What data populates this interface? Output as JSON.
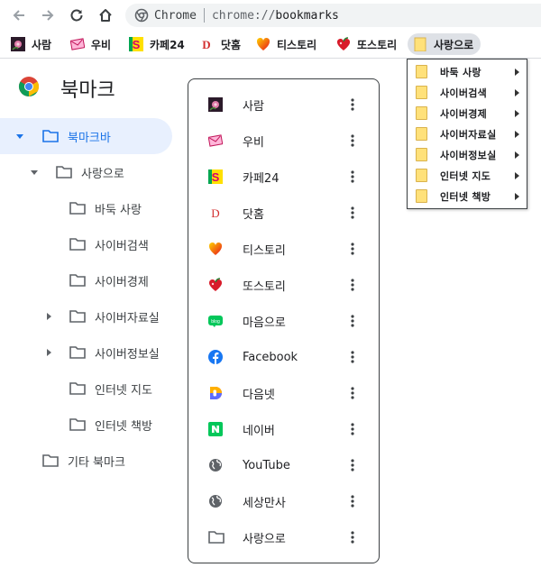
{
  "omnibox": {
    "scheme_label": "Chrome",
    "url_prefix": "chrome://",
    "url_host": "bookmarks"
  },
  "bookmarks_bar": [
    {
      "label": "사람",
      "icon": "flower-photo-icon"
    },
    {
      "label": "우비",
      "icon": "pink-envelope-icon"
    },
    {
      "label": "카페24",
      "icon": "cafe24-icon"
    },
    {
      "label": "닷홈",
      "icon": "dothome-d-icon"
    },
    {
      "label": "티스토리",
      "icon": "heart-icon"
    },
    {
      "label": "또스토리",
      "icon": "cherry-heart-icon"
    },
    {
      "label": "사랑으로",
      "icon": "folder-icon"
    }
  ],
  "page": {
    "title": "북마크"
  },
  "tree": [
    {
      "label": "북마크바"
    },
    {
      "label": "사랑으로"
    },
    {
      "label": "바둑 사랑"
    },
    {
      "label": "사이버검색"
    },
    {
      "label": "사이버경제"
    },
    {
      "label": "사이버자료실"
    },
    {
      "label": "사이버정보실"
    },
    {
      "label": "인터넷 지도"
    },
    {
      "label": "인터넷 책방"
    },
    {
      "label": "기타 북마크"
    }
  ],
  "list": [
    {
      "label": "사람"
    },
    {
      "label": "우비"
    },
    {
      "label": "카페24"
    },
    {
      "label": "닷홈"
    },
    {
      "label": "티스토리"
    },
    {
      "label": "또스토리"
    },
    {
      "label": "마음으로"
    },
    {
      "label": "Facebook"
    },
    {
      "label": "다음넷"
    },
    {
      "label": "네이버"
    },
    {
      "label": "YouTube"
    },
    {
      "label": "세상만사"
    },
    {
      "label": "사랑으로"
    }
  ],
  "dropdown": [
    {
      "label": "바둑 사랑"
    },
    {
      "label": "사이버검색"
    },
    {
      "label": "사이버경제"
    },
    {
      "label": "사이버자료실"
    },
    {
      "label": "사이버정보실"
    },
    {
      "label": "인터넷 지도"
    },
    {
      "label": "인터넷 책방"
    }
  ],
  "colors": {
    "accent": "#1a73e8",
    "selected_bg": "#e8f0fe",
    "folder": "#ffe17a"
  }
}
